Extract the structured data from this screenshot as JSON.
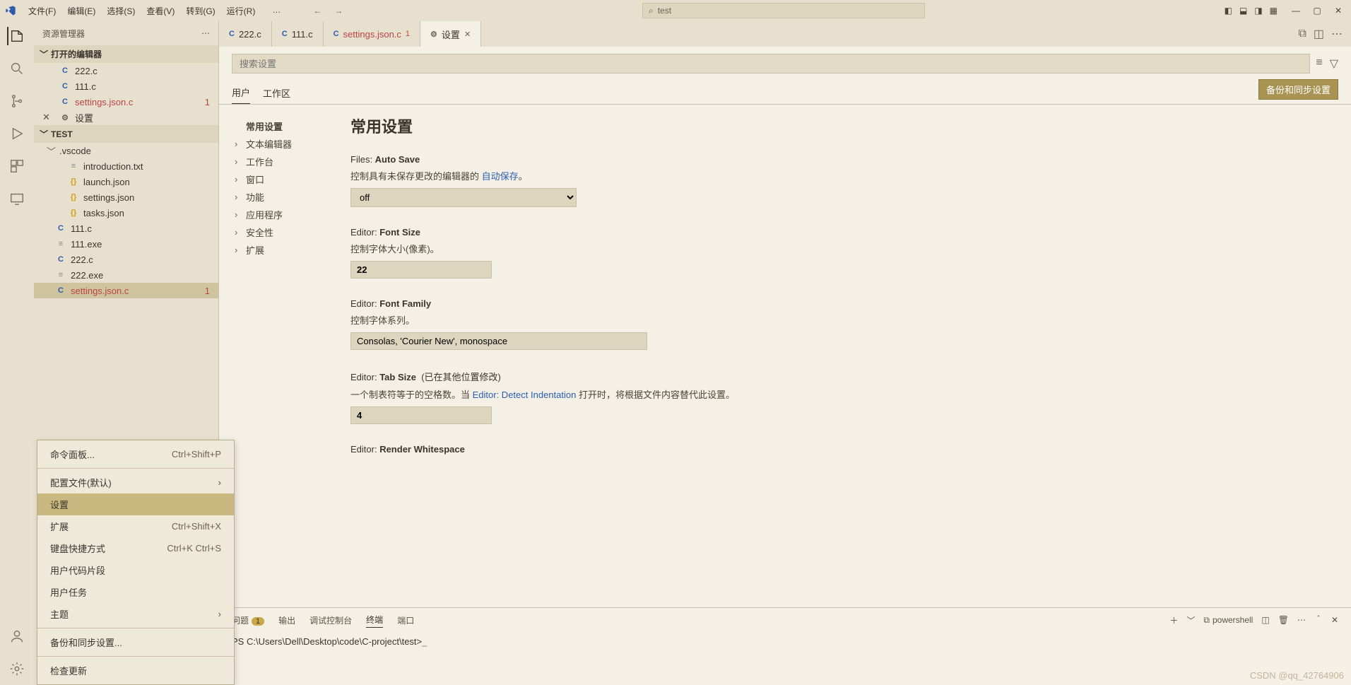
{
  "titlebar": {
    "menus": [
      "文件(F)",
      "编辑(E)",
      "选择(S)",
      "查看(V)",
      "转到(G)",
      "运行(R)"
    ],
    "more": "…",
    "search_text": "test"
  },
  "sidebar": {
    "title": "资源管理器",
    "open_editors_label": "打开的编辑器",
    "open_editors": [
      {
        "icon": "c",
        "name": "222.c"
      },
      {
        "icon": "c",
        "name": "111.c"
      },
      {
        "icon": "c",
        "name": "settings.json.c",
        "err": true,
        "badge": "1"
      },
      {
        "icon": "set",
        "name": "设置",
        "closeable": true
      }
    ],
    "project_label": "TEST",
    "tree": [
      {
        "type": "folder",
        "name": ".vscode",
        "level": 1
      },
      {
        "type": "file",
        "icon": "txt",
        "name": "introduction.txt",
        "level": 2
      },
      {
        "type": "file",
        "icon": "json",
        "name": "launch.json",
        "level": 2
      },
      {
        "type": "file",
        "icon": "json",
        "name": "settings.json",
        "level": 2
      },
      {
        "type": "file",
        "icon": "json",
        "name": "tasks.json",
        "level": 2
      },
      {
        "type": "file",
        "icon": "c",
        "name": "111.c",
        "level": 1
      },
      {
        "type": "file",
        "icon": "exe",
        "name": "111.exe",
        "level": 1
      },
      {
        "type": "file",
        "icon": "c",
        "name": "222.c",
        "level": 1
      },
      {
        "type": "file",
        "icon": "exe",
        "name": "222.exe",
        "level": 1
      },
      {
        "type": "file",
        "icon": "c",
        "name": "settings.json.c",
        "level": 1,
        "err": true,
        "badge": "1",
        "active": true
      }
    ]
  },
  "context_menu": {
    "items": [
      {
        "label": "命令面板...",
        "shortcut": "Ctrl+Shift+P"
      },
      {
        "sep": true
      },
      {
        "label": "配置文件(默认)",
        "sub": true
      },
      {
        "label": "设置",
        "selected": true
      },
      {
        "label": "扩展",
        "shortcut": "Ctrl+Shift+X"
      },
      {
        "label": "键盘快捷方式",
        "shortcut": "Ctrl+K Ctrl+S"
      },
      {
        "label": "用户代码片段"
      },
      {
        "label": "用户任务"
      },
      {
        "label": "主题",
        "sub": true
      },
      {
        "sep": true
      },
      {
        "label": "备份和同步设置..."
      },
      {
        "sep": true
      },
      {
        "label": "检查更新"
      }
    ]
  },
  "tabs": [
    {
      "icon": "c",
      "label": "222.c"
    },
    {
      "icon": "c",
      "label": "111.c"
    },
    {
      "icon": "c",
      "label": "settings.json.c",
      "err": true,
      "badge": "1"
    },
    {
      "icon": "set",
      "label": "设置",
      "active": true,
      "close": true
    }
  ],
  "settings": {
    "search_placeholder": "搜索设置",
    "scope_user": "用户",
    "scope_workspace": "工作区",
    "sync_button": "备份和同步设置",
    "toc": [
      {
        "label": "常用设置",
        "bold": true
      },
      {
        "label": "文本编辑器",
        "chev": true
      },
      {
        "label": "工作台",
        "chev": true
      },
      {
        "label": "窗口",
        "chev": true
      },
      {
        "label": "功能",
        "chev": true
      },
      {
        "label": "应用程序",
        "chev": true
      },
      {
        "label": "安全性",
        "chev": true
      },
      {
        "label": "扩展",
        "chev": true
      }
    ],
    "heading": "常用设置",
    "items": {
      "autosave": {
        "key_pre": "Files: ",
        "key": "Auto Save",
        "desc_pre": "控制具有未保存更改的编辑器的 ",
        "link": "自动保存",
        "desc_post": "。",
        "value": "off"
      },
      "fontsize": {
        "key_pre": "Editor: ",
        "key": "Font Size",
        "desc": "控制字体大小(像素)。",
        "value": "22",
        "modified": true
      },
      "fontfamily": {
        "key_pre": "Editor: ",
        "key": "Font Family",
        "desc": "控制字体系列。",
        "value": "Consolas, 'Courier New', monospace"
      },
      "tabsize": {
        "key_pre": "Editor: ",
        "key": "Tab Size",
        "note": "(已在其他位置修改)",
        "desc_pre": "一个制表符等于的空格数。当 ",
        "link": "Editor: Detect Indentation",
        "desc_post": " 打开时，将根据文件内容替代此设置。",
        "value": "4"
      },
      "renderws": {
        "key_pre": "Editor: ",
        "key": "Render Whitespace"
      }
    }
  },
  "panel": {
    "tabs": {
      "problems": "问题",
      "problems_badge": "1",
      "output": "输出",
      "debug": "调试控制台",
      "terminal": "终端",
      "ports": "端口"
    },
    "kind": "powershell",
    "prompt": "PS C:\\Users\\Dell\\Desktop\\code\\C-project\\test>"
  },
  "watermark": "CSDN @qq_42764906"
}
